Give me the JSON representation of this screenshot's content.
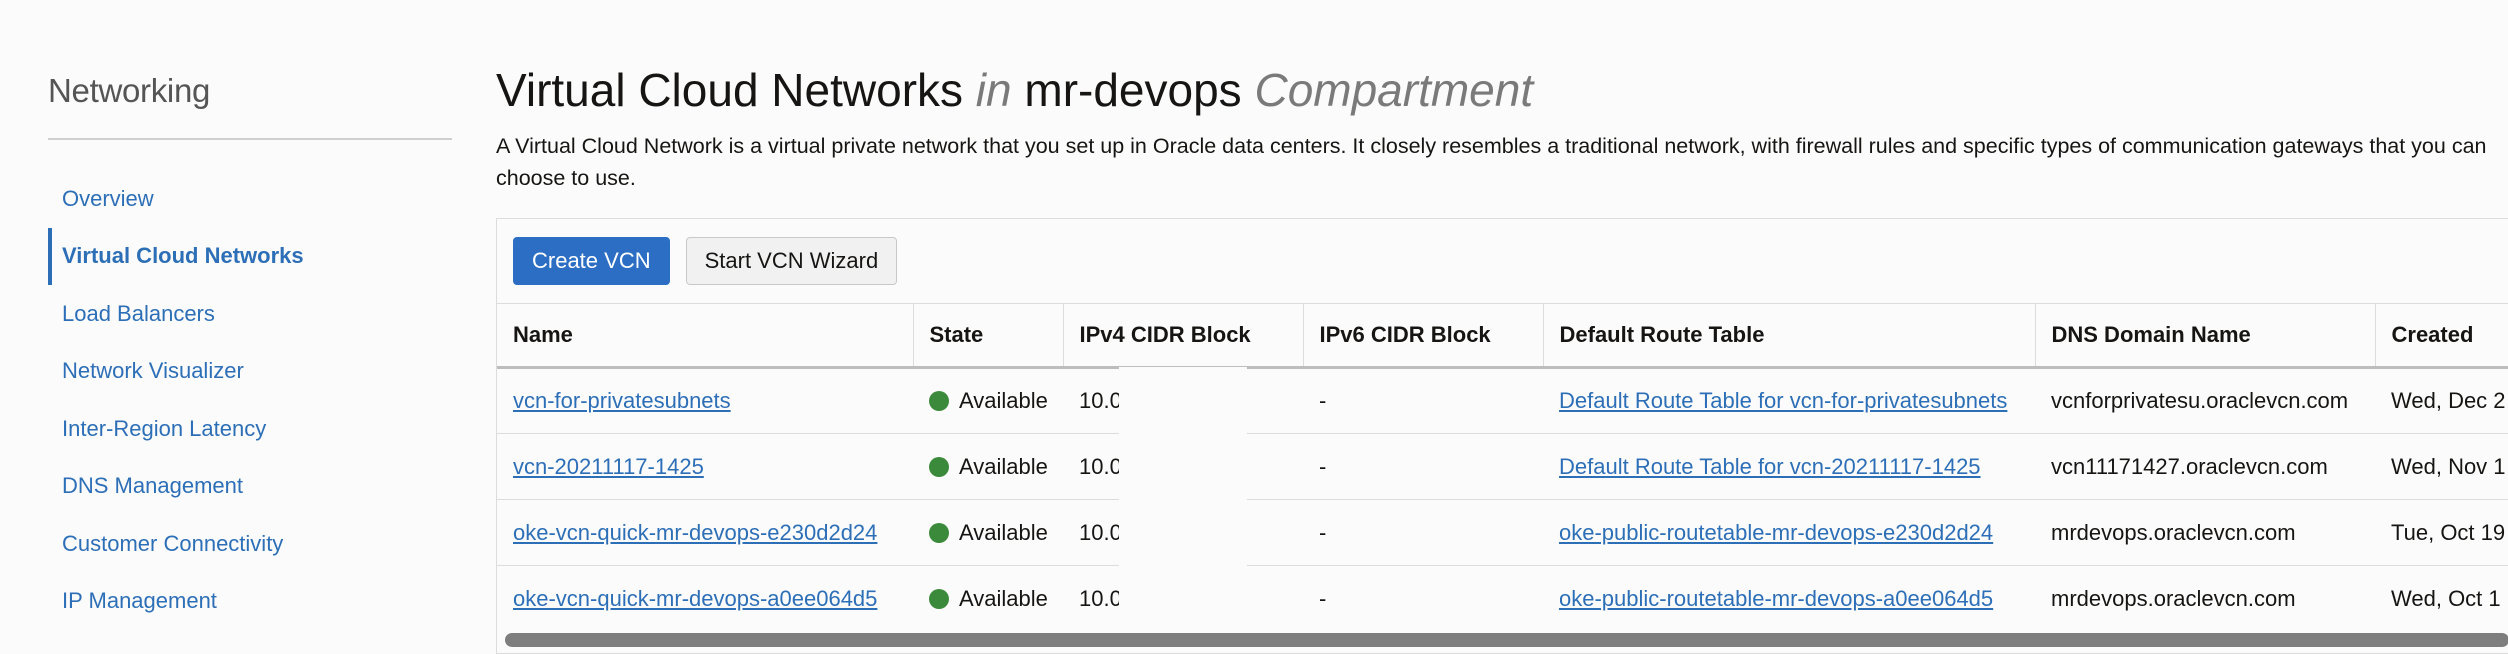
{
  "sidebar": {
    "title": "Networking",
    "items": [
      {
        "label": "Overview",
        "active": false
      },
      {
        "label": "Virtual Cloud Networks",
        "active": true
      },
      {
        "label": "Load Balancers",
        "active": false
      },
      {
        "label": "Network Visualizer",
        "active": false
      },
      {
        "label": "Inter-Region Latency",
        "active": false
      },
      {
        "label": "DNS Management",
        "active": false
      },
      {
        "label": "Customer Connectivity",
        "active": false
      },
      {
        "label": "IP Management",
        "active": false
      }
    ]
  },
  "header": {
    "title_main": "Virtual Cloud Networks",
    "title_in": "in",
    "title_compartment": "mr-devops",
    "title_suffix": "Compartment",
    "description": "A Virtual Cloud Network is a virtual private network that you set up in Oracle data centers. It closely resembles a traditional network, with firewall rules and specific types of communication gateways that you can choose to use."
  },
  "toolbar": {
    "create_label": "Create VCN",
    "wizard_label": "Start VCN Wizard"
  },
  "table": {
    "columns": [
      "Name",
      "State",
      "IPv4 CIDR Block",
      "IPv6 CIDR Block",
      "Default Route Table",
      "DNS Domain Name",
      "Created"
    ],
    "rows": [
      {
        "name": "vcn-for-privatesubnets",
        "state": "Available",
        "ipv4": "10.0",
        "ipv6": "-",
        "route_table": "Default Route Table for vcn-for-privatesubnets",
        "dns": "vcnforprivatesu.oraclevcn.com",
        "created": "Wed, Dec 2"
      },
      {
        "name": "vcn-20211117-1425",
        "state": "Available",
        "ipv4": "10.0",
        "ipv6": "-",
        "route_table": "Default Route Table for vcn-20211117-1425",
        "dns": "vcn11171427.oraclevcn.com",
        "created": "Wed, Nov 1"
      },
      {
        "name": "oke-vcn-quick-mr-devops-e230d2d24",
        "state": "Available",
        "ipv4": "10.0",
        "ipv6": "-",
        "route_table": "oke-public-routetable-mr-devops-e230d2d24",
        "dns": "mrdevops.oraclevcn.com",
        "created": "Tue, Oct 19"
      },
      {
        "name": "oke-vcn-quick-mr-devops-a0ee064d5",
        "state": "Available",
        "ipv4": "10.0",
        "ipv6": "-",
        "route_table": "oke-public-routetable-mr-devops-a0ee064d5",
        "dns": "mrdevops.oraclevcn.com",
        "created": "Wed, Oct 1"
      }
    ]
  },
  "colors": {
    "link": "#2d6fb7",
    "primary_button": "#2c6ec4",
    "available_dot": "#3b8a3b"
  }
}
